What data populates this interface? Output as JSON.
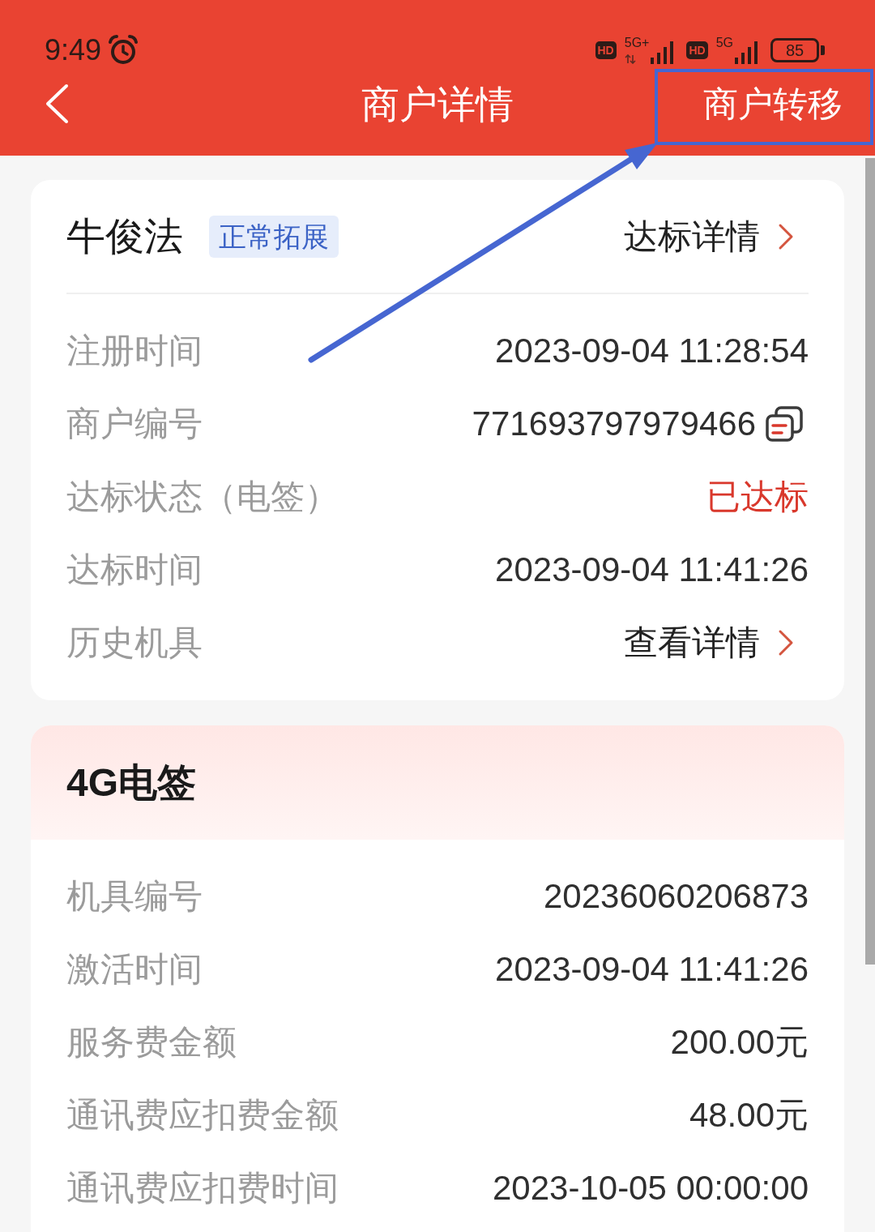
{
  "status_bar": {
    "time": "9:49",
    "sims": [
      {
        "hd": "HD",
        "network": "5G+",
        "data_activity": true
      },
      {
        "hd": "HD",
        "network": "5G",
        "data_activity": false
      }
    ],
    "battery": "85"
  },
  "nav_bar": {
    "title": "商户详情",
    "action": "商户转移"
  },
  "merchant": {
    "name": "牛俊法",
    "tag": "正常拓展",
    "link": "达标详情",
    "fields": [
      {
        "label": "注册时间",
        "value": "2023-09-04 11:28:54",
        "kind": "text"
      },
      {
        "label": "商户编号",
        "value": "771693797979466",
        "kind": "copy"
      },
      {
        "label": "达标状态（电签）",
        "value": "已达标",
        "kind": "status"
      },
      {
        "label": "达标时间",
        "value": "2023-09-04 11:41:26",
        "kind": "text"
      },
      {
        "label": "历史机具",
        "value": "查看详情",
        "kind": "link"
      }
    ]
  },
  "device": {
    "title": "4G电签",
    "fields": [
      {
        "label": "机具编号",
        "value": "20236060206873",
        "kind": "text"
      },
      {
        "label": "激活时间",
        "value": "2023-09-04 11:41:26",
        "kind": "text"
      },
      {
        "label": "服务费金额",
        "value": "200.00元",
        "kind": "text"
      },
      {
        "label": "通讯费应扣费金额",
        "value": "48.00元",
        "kind": "text"
      },
      {
        "label": "通讯费应扣费时间",
        "value": "2023-10-05 00:00:00",
        "kind": "text"
      }
    ]
  }
}
